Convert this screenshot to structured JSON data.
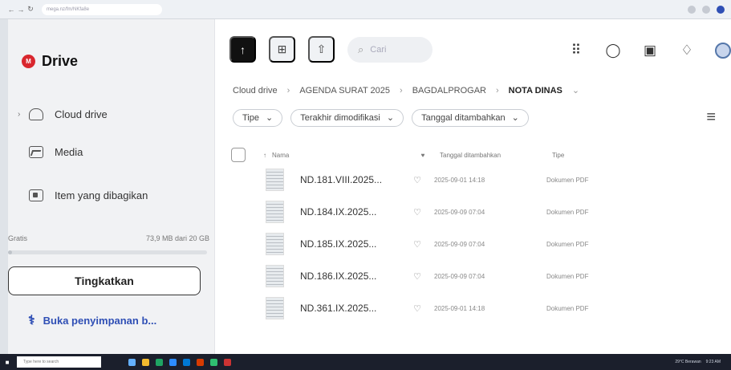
{
  "browser": {
    "address": "mega.nz/fm/NKfa8e",
    "controls": [
      "←",
      "→",
      "↻"
    ]
  },
  "sidebar": {
    "logo": {
      "mark": "M",
      "text": "Drive"
    },
    "items": [
      {
        "label": "Cloud drive",
        "icon": "cloud-icon",
        "chevron": "›"
      },
      {
        "label": "Media",
        "icon": "media-icon"
      },
      {
        "label": "Item yang dibagikan",
        "icon": "shared-items-icon"
      }
    ],
    "storage": {
      "plan": "Gratis",
      "usage": "73,9 MB dari 20 GB",
      "used_fraction": 0.004
    },
    "upgrade_label": "Tingkatkan",
    "open_storage_label": "Buka penyimpanan b..."
  },
  "toolbar": {
    "buttons": [
      {
        "name": "upload-button",
        "glyph": "↑"
      },
      {
        "name": "new-folder-button",
        "glyph": "⊞"
      },
      {
        "name": "share-button",
        "glyph": "⇧"
      }
    ],
    "search_placeholder": "Cari"
  },
  "breadcrumb": [
    "Cloud drive",
    "AGENDA SURAT 2025",
    "BAGDALPROGAR",
    "NOTA DINAS"
  ],
  "filters": [
    "Tipe",
    "Terakhir dimodifikasi",
    "Tanggal ditambahkan"
  ],
  "table": {
    "headers": {
      "name": "Nama",
      "date": "Tanggal ditambahkan",
      "type": "Tipe"
    },
    "rows": [
      {
        "name": "ND.181.VIII.2025...",
        "date": "2025-09-01 14:18",
        "type": "Dokumen PDF"
      },
      {
        "name": "ND.184.IX.2025...",
        "date": "2025-09-09 07:04",
        "type": "Dokumen PDF"
      },
      {
        "name": "ND.185.IX.2025...",
        "date": "2025-09-09 07:04",
        "type": "Dokumen PDF"
      },
      {
        "name": "ND.186.IX.2025...",
        "date": "2025-09-09 07:04",
        "type": "Dokumen PDF"
      },
      {
        "name": "ND.361.IX.2025...",
        "date": "2025-09-01 14:18",
        "type": "Dokumen PDF"
      }
    ]
  },
  "taskbar": {
    "search_placeholder": "Type here to search",
    "status": "29°C Berawan",
    "clock": "9:23 AM"
  }
}
